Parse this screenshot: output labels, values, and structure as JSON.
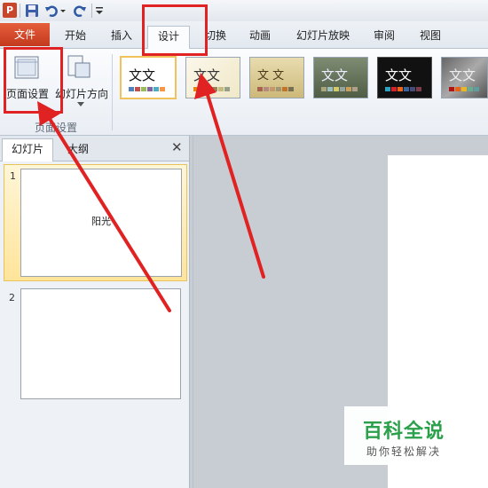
{
  "quick_access": {
    "app_icon": "powerpoint-app-icon",
    "icons": [
      "save-icon",
      "undo-icon",
      "undo-dropdown-icon",
      "redo-icon",
      "customize-qat-icon"
    ]
  },
  "ribbon_tabs": {
    "file": "文件",
    "home": "开始",
    "insert": "插入",
    "design": "设计",
    "transitions": "切换",
    "animations": "动画",
    "slideshow": "幻灯片放映",
    "review": "审阅",
    "view": "视图"
  },
  "page_setup_group": {
    "page_setup_label": "页面设置",
    "orientation_label": "幻灯片方向",
    "group_label": "页面设置"
  },
  "themes": {
    "sample_text": "文文",
    "sample_text_spaced": "文 文"
  },
  "slide_panel": {
    "tab_slides": "幻灯片",
    "tab_outline": "大纲",
    "close_glyph": "✕",
    "slides": [
      {
        "number": "1",
        "text": "阳光"
      },
      {
        "number": "2",
        "text": ""
      }
    ]
  },
  "watermark": {
    "title": "百科全说",
    "subtitle": "助你轻松解决"
  },
  "colors": {
    "file_tab": "#d44a2a",
    "annotation": "#e02222",
    "selection": "#f2c25a",
    "watermark_green": "#2aa04a"
  }
}
